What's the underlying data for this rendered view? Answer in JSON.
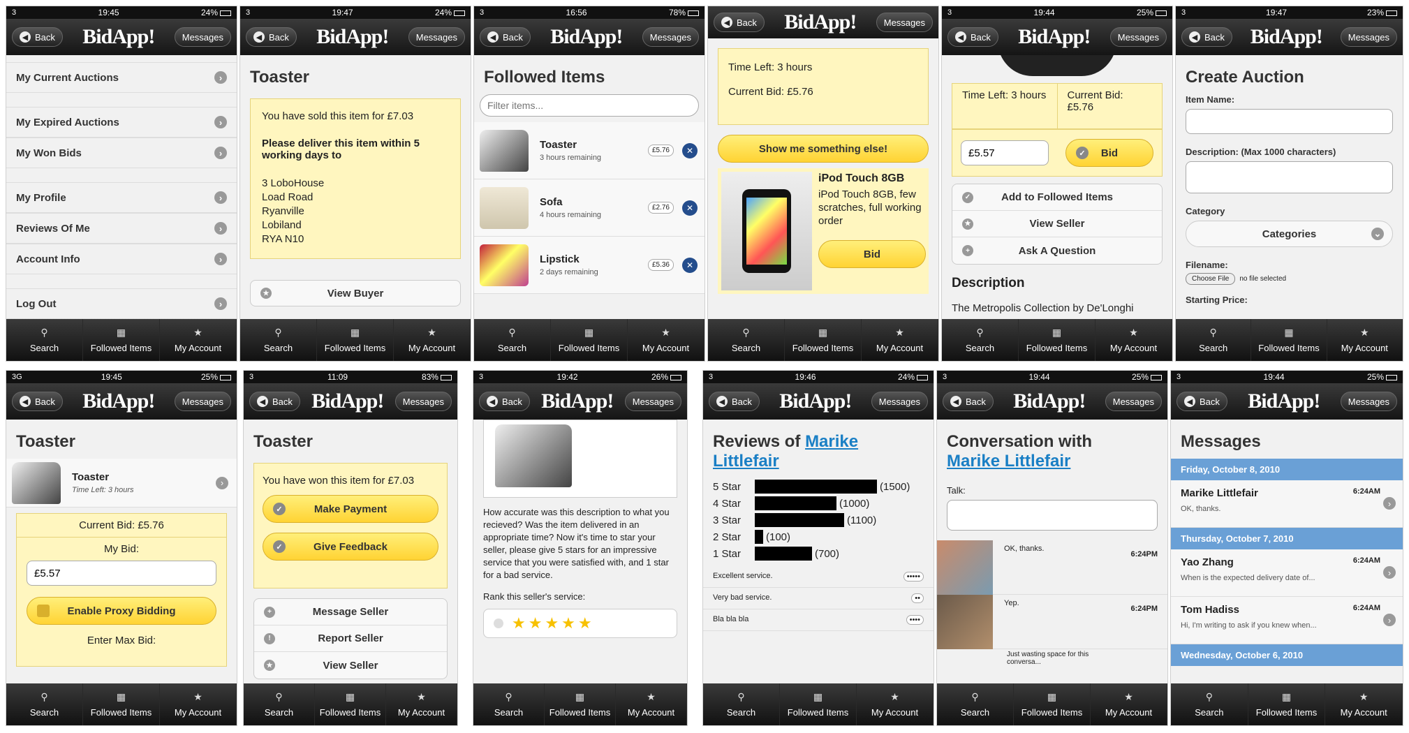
{
  "common": {
    "back": "Back",
    "logo": "BidApp!",
    "messages": "Messages",
    "tabs": {
      "search": "Search",
      "followed": "Followed Items",
      "account": "My Account"
    }
  },
  "status": [
    {
      "carrier": "3",
      "time": "19:45",
      "batt": "24%"
    },
    {
      "carrier": "3",
      "time": "19:47",
      "batt": "24%"
    },
    {
      "carrier": "3",
      "time": "16:56",
      "batt": "78%"
    },
    {
      "carrier": "",
      "time": "",
      "batt": ""
    },
    {
      "carrier": "3",
      "time": "19:44",
      "batt": "25%"
    },
    {
      "carrier": "3",
      "time": "19:47",
      "batt": "23%"
    },
    {
      "carrier": "3G",
      "time": "19:45",
      "batt": "25%"
    },
    {
      "carrier": "3",
      "time": "11:09",
      "batt": "83%"
    },
    {
      "carrier": "3",
      "time": "19:42",
      "batt": "26%"
    },
    {
      "carrier": "3",
      "time": "19:46",
      "batt": "24%"
    },
    {
      "carrier": "3",
      "time": "19:44",
      "batt": "25%"
    },
    {
      "carrier": "3",
      "time": "19:44",
      "batt": "25%"
    }
  ],
  "s1": {
    "items": [
      "My Current Auctions",
      "My Expired Auctions",
      "My Won Bids",
      "My Profile",
      "Reviews Of Me",
      "Account Info",
      "Log Out"
    ]
  },
  "s2": {
    "title": "Toaster",
    "sold": "You have sold this item for £7.03",
    "deliver": "Please deliver this item within 5 working days to",
    "address": [
      "3 LoboHouse",
      "Load Road",
      "Ryanville",
      "Lobiland",
      "RYA N10"
    ],
    "view_buyer": "View Buyer"
  },
  "s3": {
    "title": "Followed Items",
    "filter_placeholder": "Filter items...",
    "items": [
      {
        "name": "Toaster",
        "time": "3 hours remaining",
        "price": "£5.76"
      },
      {
        "name": "Sofa",
        "time": "4 hours remaining",
        "price": "£2.76"
      },
      {
        "name": "Lipstick",
        "time": "2 days remaining",
        "price": "£5.36"
      }
    ]
  },
  "s4": {
    "time_left": "Time Left: 3 hours",
    "current_bid": "Current Bid: £5.76",
    "show_me": "Show me something else!",
    "item_title": "iPod Touch 8GB",
    "item_desc": "iPod Touch 8GB, few scratches, full working order",
    "bid": "Bid"
  },
  "s5": {
    "time_left": "Time Left: 3 hours",
    "current_bid": "Current Bid: £5.76",
    "bid_value": "£5.57",
    "bid": "Bid",
    "add_follow": "Add to Followed Items",
    "view_seller": "View Seller",
    "ask": "Ask A Question",
    "desc_title": "Description",
    "desc": "The Metropolis Collection by De'Longhi"
  },
  "s6": {
    "title": "Create Auction",
    "item_name": "Item Name:",
    "description": "Description: (Max 1000 characters)",
    "category": "Category",
    "categories": "Categories",
    "filename": "Filename:",
    "choose": "Choose File",
    "no_file": "no file selected",
    "starting_price": "Starting Price:"
  },
  "s7": {
    "title": "Toaster",
    "item": "Toaster",
    "time_left": "Time Left: 3 hours",
    "current_bid": "Current Bid: £5.76",
    "my_bid": "My Bid:",
    "my_bid_value": "£5.57",
    "proxy": "Enable Proxy Bidding",
    "max_bid": "Enter Max Bid:"
  },
  "s8": {
    "title": "Toaster",
    "won": "You have won this item for £7.03",
    "make_payment": "Make Payment",
    "give_feedback": "Give Feedback",
    "message_seller": "Message Seller",
    "report_seller": "Report Seller",
    "view_seller": "View Seller"
  },
  "s9": {
    "question": "How accurate was this description to what you recieved? Was the item delivered in an appropriate time? Now it's time to star your seller, please give 5 stars for an impressive service that you were satisfied with, and 1 star for a bad service.",
    "rank": "Rank this seller's service:",
    "stars": "★★★★★"
  },
  "s10": {
    "title_prefix": "Reviews of",
    "name": "Marike Littlefair",
    "rows": [
      {
        "label": "5 Star",
        "count": "(1500)",
        "value": 1500
      },
      {
        "label": "4 Star",
        "count": "(1000)",
        "value": 1000
      },
      {
        "label": "3 Star",
        "count": "(1100)",
        "value": 1100
      },
      {
        "label": "2 Star",
        "count": "(100)",
        "value": 100
      },
      {
        "label": "1 Star",
        "count": "(700)",
        "value": 700
      }
    ],
    "reviews": [
      "Excellent service.",
      "Very bad service.",
      "Bla bla bla"
    ]
  },
  "s11": {
    "title": "Conversation with",
    "name": "Marike Littlefair",
    "talk": "Talk:",
    "msgs": [
      {
        "text": "OK, thanks.",
        "time": "6:24PM"
      },
      {
        "text": "Yep.",
        "time": "6:24PM"
      },
      {
        "text": "Just wasting space for this conversa...",
        "time": ""
      }
    ]
  },
  "s12": {
    "title": "Messages",
    "sections": [
      "Friday, October 8, 2010",
      "Thursday, October 7, 2010",
      "Wednesday, October 6, 2010"
    ],
    "msgs": [
      {
        "name": "Marike Littlefair",
        "preview": "OK, thanks.",
        "time": "6:24AM"
      },
      {
        "name": "Yao Zhang",
        "preview": "When is the expected delivery date of...",
        "time": "6:24AM"
      },
      {
        "name": "Tom Hadiss",
        "preview": "Hi, I'm writing to ask if you knew when...",
        "time": "6:24AM"
      }
    ]
  }
}
